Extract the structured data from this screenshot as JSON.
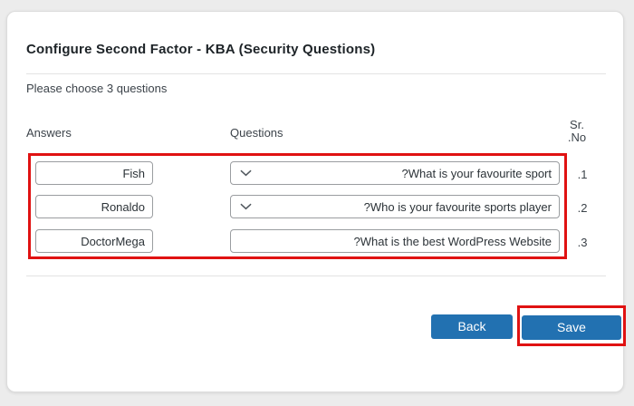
{
  "header": {
    "title": "Configure Second Factor - KBA (Security Questions)",
    "instruction": "Please choose 3 questions"
  },
  "table": {
    "headers": {
      "answers": "Answers",
      "questions": "Questions",
      "sr_no": "Sr. No."
    },
    "rows": [
      {
        "sr": "1.",
        "answer": "Fish",
        "question": "What is your favourite sport?"
      },
      {
        "sr": "2.",
        "answer": "Ronaldo",
        "question": "Who is your favourite sports player?"
      },
      {
        "sr": "3.",
        "answer": "DoctorMega",
        "question": "What is the best WordPress Website?"
      }
    ]
  },
  "buttons": {
    "back": "Back",
    "save": "Save"
  },
  "colors": {
    "button_blue": "#2271b1",
    "annotation_red": "#e01212"
  },
  "icons": {
    "question_dropdown": "chevron-down-icon"
  }
}
